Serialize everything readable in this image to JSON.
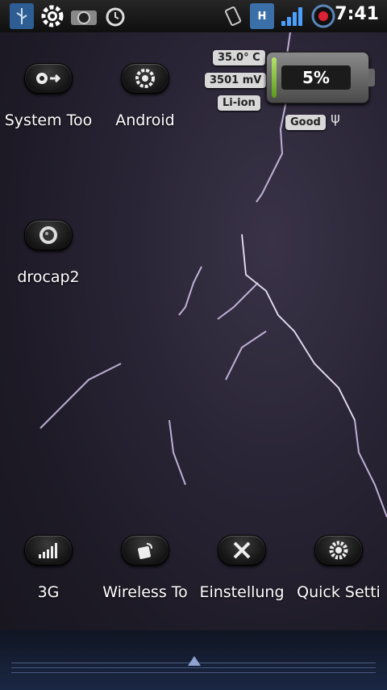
{
  "status_bar": {
    "icons": [
      "usb-icon",
      "gear-icon",
      "camera-icon",
      "alarm-clock-icon",
      "vibrate-icon",
      "hspa-data-icon",
      "signal-strength-icon",
      "battery-circle-icon"
    ],
    "clock": "7:41",
    "data_indicator": "H"
  },
  "battery_widget": {
    "temperature": "35.0° C",
    "voltage": "3501 mV",
    "technology": "Li-ion",
    "percent_label": "5%",
    "level": 0.05,
    "health": "Good"
  },
  "apps_top": [
    {
      "label": "System Too",
      "icon": "system-tools-icon"
    },
    {
      "label": "Android",
      "icon": "gears-icon"
    }
  ],
  "apps_mid": [
    {
      "label": "drocap2",
      "icon": "camera-lens-icon"
    }
  ],
  "apps_bottom": [
    {
      "label": "3G",
      "icon": "signal-bars-icon"
    },
    {
      "label": "Wireless To",
      "icon": "wireless-lock-icon"
    },
    {
      "label": "Einstellung",
      "icon": "tools-icon"
    },
    {
      "label": "Quick Setti",
      "icon": "settings-gear-icon"
    }
  ],
  "colors": {
    "battery_fill": "#8fcf3a",
    "dock_arrow": "#8fa3d0"
  }
}
